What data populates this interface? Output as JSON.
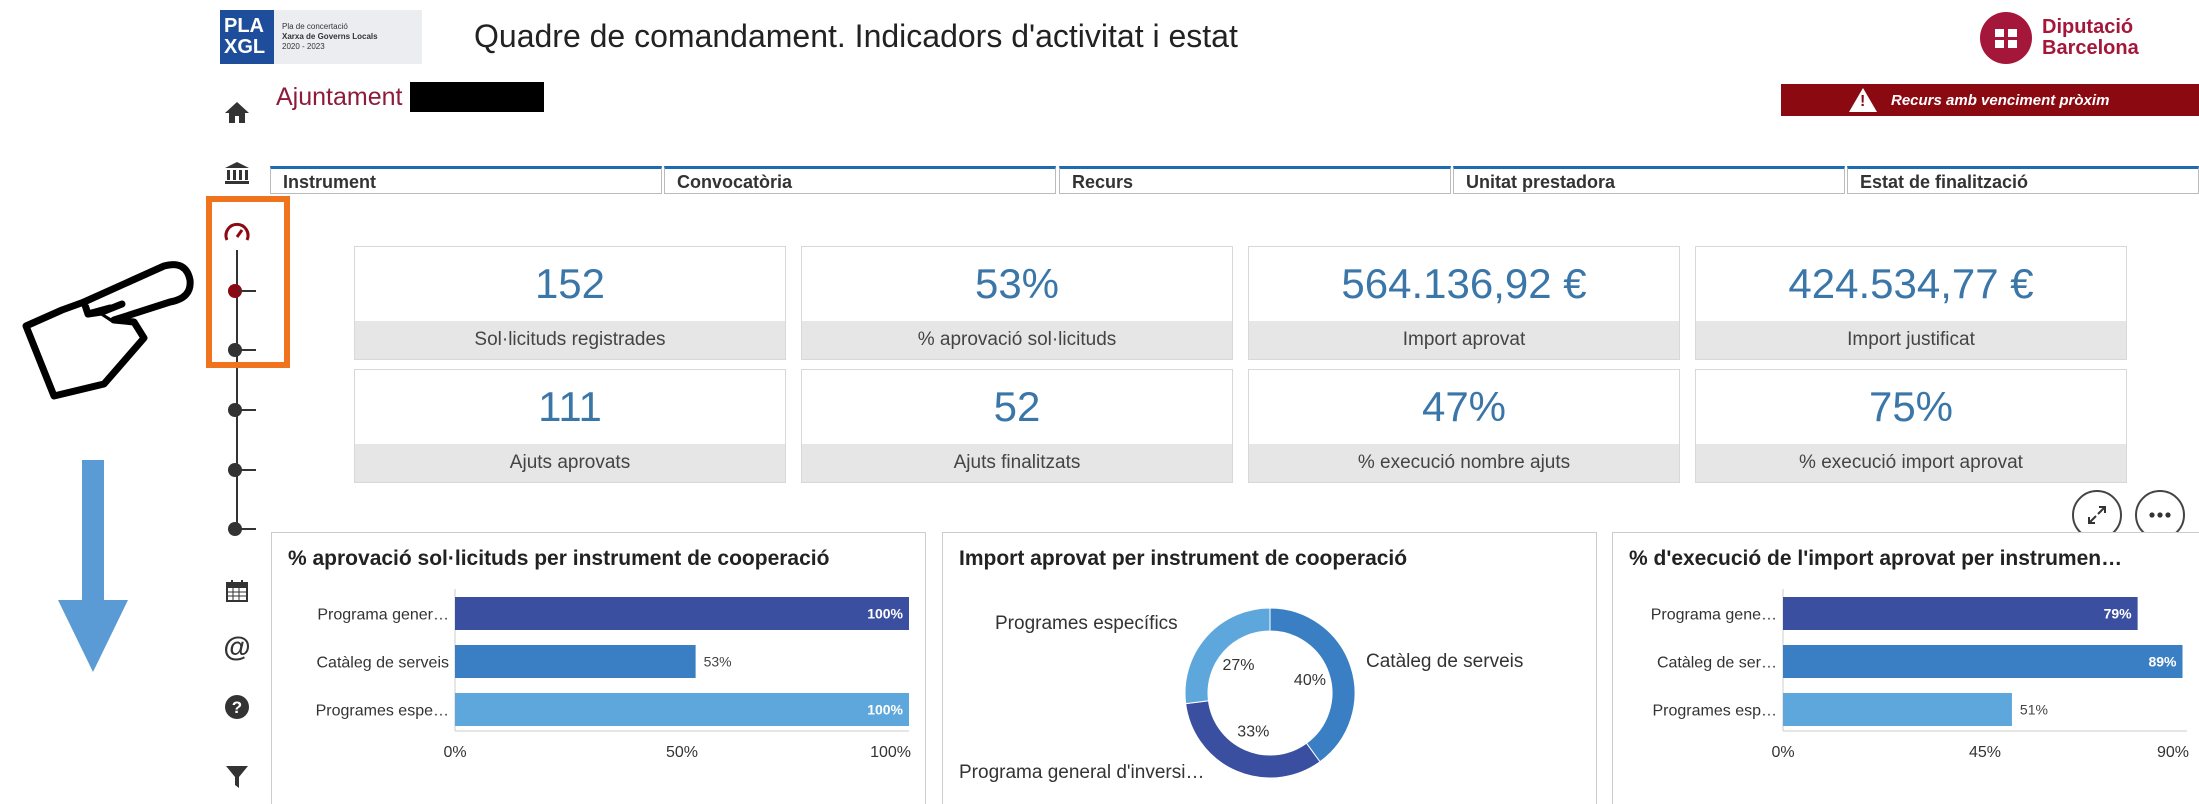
{
  "header": {
    "plan_logo_mark": "PLA XGL",
    "plan_logo_line1": "Pla de concertació",
    "plan_logo_line2": "Xarxa de Governs Locals",
    "plan_logo_line3": "2020 - 2023",
    "title": "Quadre de comandament. Indicadors d'activitat i estat",
    "brand_line1": "Diputació",
    "brand_line2": "Barcelona"
  },
  "ajuntament_label": "Ajuntament",
  "alert": {
    "text": "Recurs amb venciment pròxim",
    "icon": "warning-icon",
    "color": "#8b0a12"
  },
  "sidebar": {
    "icons": [
      "home-icon",
      "institution-icon",
      "dashboard-gauge-icon",
      "calendar-icon",
      "at-icon",
      "help-icon",
      "filter-icon"
    ]
  },
  "filters": [
    {
      "label": "Instrument"
    },
    {
      "label": "Convocatòria"
    },
    {
      "label": "Recurs"
    },
    {
      "label": "Unitat prestadora"
    },
    {
      "label": "Estat de finalització"
    }
  ],
  "kpis": [
    {
      "value": "152",
      "label": "Sol·licituds registrades"
    },
    {
      "value": "53%",
      "label": "% aprovació sol·licituds"
    },
    {
      "value": "564.136,92 €",
      "label": "Import aprovat"
    },
    {
      "value": "424.534,77 €",
      "label": "Import justificat"
    },
    {
      "value": "111",
      "label": "Ajuts aprovats"
    },
    {
      "value": "52",
      "label": "Ajuts finalitzats"
    },
    {
      "value": "47%",
      "label": "% execució nombre ajuts"
    },
    {
      "value": "75%",
      "label": "% execució import aprovat"
    }
  ],
  "panel_actions": {
    "expand_icon": "expand-icon",
    "more_icon": "more-icon"
  },
  "chart_data": [
    {
      "type": "bar",
      "orientation": "horizontal",
      "title": "% aprovació sol·licituds per instrument de cooperació",
      "categories": [
        "Programa gener…",
        "Catàleg de serveis",
        "Programes espe…"
      ],
      "values": [
        100,
        53,
        100
      ],
      "data_labels": [
        "100%",
        "53%",
        "100%"
      ],
      "colors": [
        "#3a4fa0",
        "#3a7fc4",
        "#5ea7dc"
      ],
      "xlim": [
        0,
        100
      ],
      "ticks": [
        "0%",
        "50%",
        "100%"
      ]
    },
    {
      "type": "pie",
      "donut": true,
      "title": "Import aprovat per instrument de cooperació",
      "slices": [
        {
          "label": "Catàleg de serveis",
          "value": 40,
          "display": "40%",
          "color": "#3a7fc4"
        },
        {
          "label": "Programa general d'inversi…",
          "value": 33,
          "display": "33%",
          "color": "#3a4fa0"
        },
        {
          "label": "Programes específics",
          "value": 27,
          "display": "27%",
          "color": "#5ea7dc"
        }
      ]
    },
    {
      "type": "bar",
      "orientation": "horizontal",
      "title": "% d'execució de l'import aprovat per instrumen…",
      "categories": [
        "Programa gene…",
        "Catàleg de ser…",
        "Programes esp…"
      ],
      "values": [
        79,
        89,
        51
      ],
      "data_labels": [
        "79%",
        "89%",
        "51%"
      ],
      "colors": [
        "#3a4fa0",
        "#3a7fc4",
        "#5ea7dc"
      ],
      "xlim": [
        0,
        90
      ],
      "ticks": [
        "0%",
        "45%",
        "90%"
      ]
    }
  ]
}
